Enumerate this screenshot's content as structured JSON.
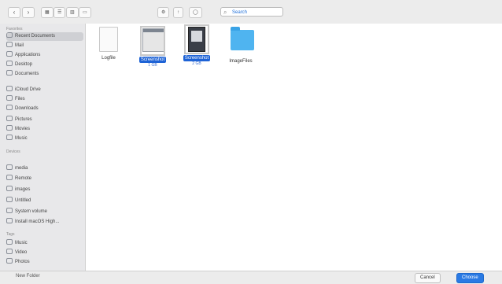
{
  "toolbar": {
    "back_icon": "chevron-left-icon",
    "forward_icon": "chevron-right-icon",
    "view_modes": [
      "▦",
      "☰",
      "▥",
      "▭"
    ],
    "group": "⚙",
    "share": "↑",
    "tag": "◯",
    "search_placeholder": "Search"
  },
  "sidebar": {
    "favorites_header": "Favorites",
    "favorites": [
      {
        "label": "Recent Documents",
        "icon": "clock-icon"
      },
      {
        "label": "Mail",
        "icon": "mail-icon"
      },
      {
        "label": "Applications",
        "icon": "apps-icon"
      },
      {
        "label": "Desktop",
        "icon": "desktop-icon"
      },
      {
        "label": "Documents",
        "icon": "document-icon"
      },
      {
        "label": "iCloud Drive",
        "icon": "cloud-icon"
      },
      {
        "label": "Files",
        "icon": "folder-icon"
      },
      {
        "label": "Downloads",
        "icon": "download-icon"
      },
      {
        "label": "Pictures",
        "icon": "pictures-icon"
      },
      {
        "label": "Movies",
        "icon": "movies-icon"
      },
      {
        "label": "Music",
        "icon": "music-icon"
      }
    ],
    "devices_header": "Devices",
    "devices": [
      {
        "label": "media",
        "icon": "disk-icon"
      },
      {
        "label": "Remote",
        "icon": "network-icon"
      },
      {
        "label": "images",
        "icon": "disk-icon"
      },
      {
        "label": "Untitled",
        "icon": "disk-icon"
      },
      {
        "label": "System volume",
        "icon": "disk-icon"
      },
      {
        "label": "Install macOS High...",
        "icon": "disk-icon"
      }
    ],
    "tags_header": "Tags",
    "tags": [
      {
        "label": "Music",
        "icon": "music-icon"
      },
      {
        "label": "Video",
        "icon": "video-icon"
      },
      {
        "label": "Photos",
        "icon": "photo-icon"
      }
    ]
  },
  "files": [
    {
      "name": "Logfile",
      "kind": "doc",
      "selected": false,
      "sub": ""
    },
    {
      "name": "Screenshot",
      "kind": "shot1",
      "selected": true,
      "sub": "1 GB"
    },
    {
      "name": "Screenshot",
      "kind": "shot2",
      "selected": true,
      "sub": "2 GB"
    },
    {
      "name": "ImageFiles",
      "kind": "folder",
      "selected": false,
      "sub": ""
    }
  ],
  "status": {
    "text": "New Folder",
    "cancel": "Cancel",
    "confirm": "Choose"
  }
}
